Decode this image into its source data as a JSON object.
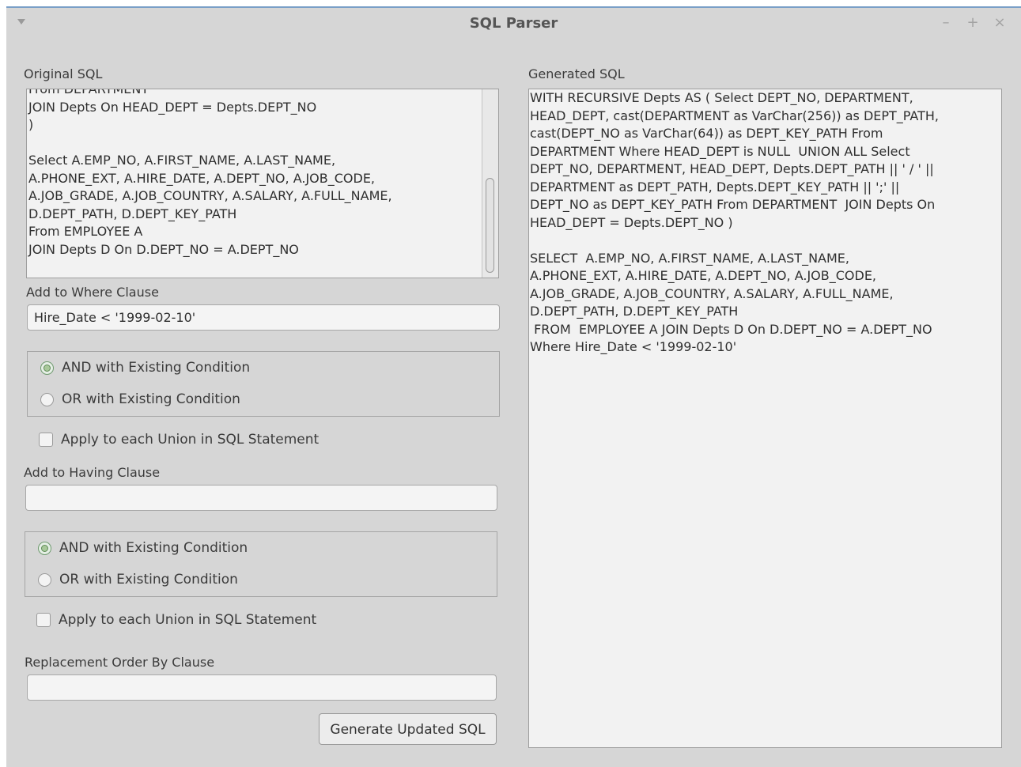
{
  "window": {
    "title": "SQL Parser",
    "minimize": "–",
    "maximize": "+",
    "close": "×"
  },
  "original_sql": {
    "label": "Original SQL",
    "text": "From DEPARTMENT\nJOIN Depts On HEAD_DEPT = Depts.DEPT_NO\n)\n\nSelect A.EMP_NO, A.FIRST_NAME, A.LAST_NAME,\nA.PHONE_EXT, A.HIRE_DATE, A.DEPT_NO, A.JOB_CODE,\nA.JOB_GRADE, A.JOB_COUNTRY, A.SALARY, A.FULL_NAME,\nD.DEPT_PATH, D.DEPT_KEY_PATH\nFrom EMPLOYEE A\nJOIN Depts D On D.DEPT_NO = A.DEPT_NO"
  },
  "where": {
    "label": "Add to Where Clause",
    "value": "Hire_Date < '1999-02-10'",
    "and_label": "AND with Existing Condition",
    "or_label": "OR with Existing Condition",
    "union_label": "Apply to each Union in SQL Statement"
  },
  "having": {
    "label": "Add to Having Clause",
    "value": "",
    "and_label": "AND with Existing Condition",
    "or_label": "OR with Existing Condition",
    "union_label": "Apply to each Union in SQL Statement"
  },
  "order_by": {
    "label": "Replacement Order By Clause",
    "value": ""
  },
  "generate_button": "Generate Updated SQL",
  "generated_sql": {
    "label": "Generated SQL",
    "text": "WITH RECURSIVE Depts AS ( Select DEPT_NO, DEPARTMENT,\nHEAD_DEPT, cast(DEPARTMENT as VarChar(256)) as DEPT_PATH,\ncast(DEPT_NO as VarChar(64)) as DEPT_KEY_PATH From\nDEPARTMENT Where HEAD_DEPT is NULL  UNION ALL Select\nDEPT_NO, DEPARTMENT, HEAD_DEPT, Depts.DEPT_PATH || ' / ' ||\nDEPARTMENT as DEPT_PATH, Depts.DEPT_KEY_PATH || ';' ||\nDEPT_NO as DEPT_KEY_PATH From DEPARTMENT  JOIN Depts On\nHEAD_DEPT = Depts.DEPT_NO )\n\nSELECT  A.EMP_NO, A.FIRST_NAME, A.LAST_NAME,\nA.PHONE_EXT, A.HIRE_DATE, A.DEPT_NO, A.JOB_CODE,\nA.JOB_GRADE, A.JOB_COUNTRY, A.SALARY, A.FULL_NAME,\nD.DEPT_PATH, D.DEPT_KEY_PATH\n FROM  EMPLOYEE A JOIN Depts D On D.DEPT_NO = A.DEPT_NO\nWhere Hire_Date < '1999-02-10'"
  }
}
